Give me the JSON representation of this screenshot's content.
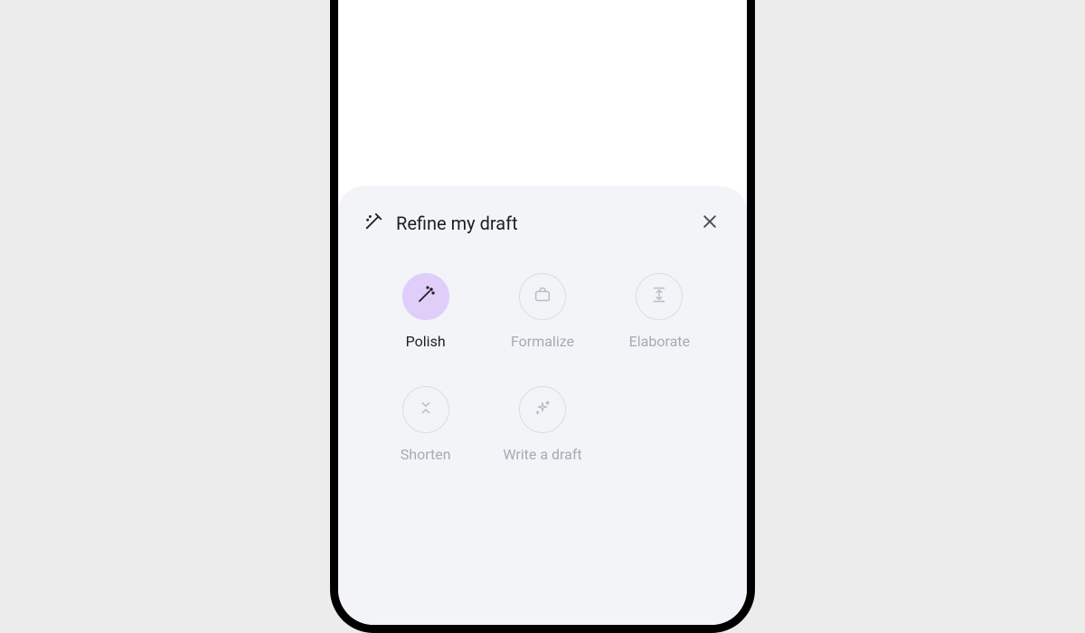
{
  "sheet": {
    "title": "Refine my draft"
  },
  "options": {
    "polish": {
      "label": "Polish"
    },
    "formalize": {
      "label": "Formalize"
    },
    "elaborate": {
      "label": "Elaborate"
    },
    "shorten": {
      "label": "Shorten"
    },
    "write": {
      "label": "Write a draft"
    }
  }
}
